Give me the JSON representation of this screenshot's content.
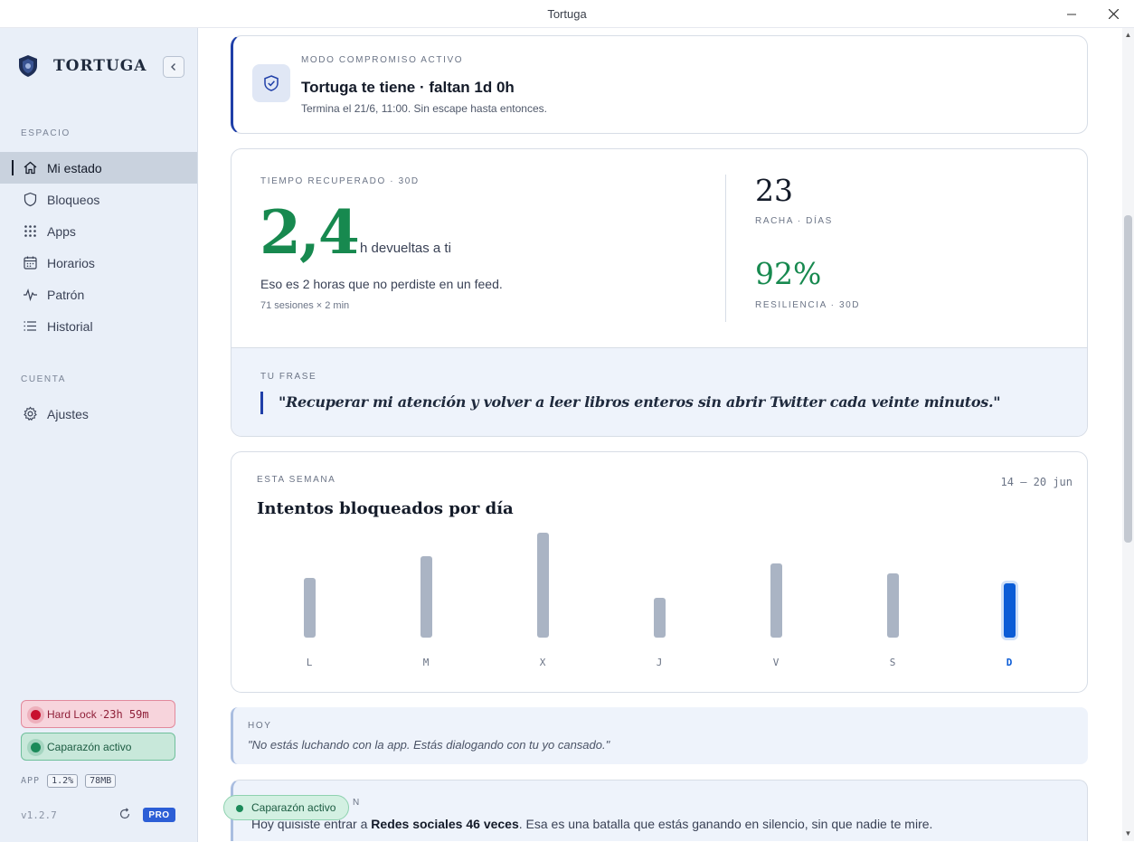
{
  "window": {
    "title": "Tortuga",
    "min_icon": "minimize-icon",
    "close_icon": "close-icon"
  },
  "sidebar": {
    "brand": "TORTUGA",
    "sections": {
      "space": "ESPACIO",
      "account": "CUENTA"
    },
    "items": [
      {
        "label": "Mi estado",
        "icon": "home-icon",
        "active": true
      },
      {
        "label": "Bloqueos",
        "icon": "shield-icon"
      },
      {
        "label": "Apps",
        "icon": "grid-icon"
      },
      {
        "label": "Horarios",
        "icon": "calendar-icon"
      },
      {
        "label": "Patrón",
        "icon": "pulse-icon"
      },
      {
        "label": "Historial",
        "icon": "list-icon"
      }
    ],
    "settings": {
      "label": "Ajustes",
      "icon": "gear-icon"
    },
    "hard_lock": {
      "label": "Hard Lock · ",
      "time": "23h 59m"
    },
    "shell": "Caparazón activo",
    "app": {
      "label": "APP",
      "cpu": "1.2%",
      "mem": "78MB"
    },
    "version": "v1.2.7",
    "pro": "PRO"
  },
  "commit": {
    "eyebrow": "MODO COMPROMISO ACTIVO",
    "title": "Tortuga te tiene · faltan 1d 0h",
    "subtitle": "Termina el 21/6, 11:00. Sin escape hasta entonces."
  },
  "stats": {
    "eyebrow": "TIEMPO RECUPERADO · 30D",
    "hours": "2,4",
    "unit": "h devueltas a ti",
    "desc": "Eso es 2 horas que no perdiste en un feed.",
    "detail": "71 sesiones × 2 min",
    "streak": "23",
    "streak_label": "RACHA · DÍAS",
    "resilience": "92%",
    "resilience_label": "RESILIENCIA · 30D",
    "phrase_label": "TU FRASE",
    "phrase": "\"Recuperar mi atención y volver a leer libros enteros sin abrir Twitter cada veinte minutos.\""
  },
  "week": {
    "eyebrow": "ESTA SEMANA",
    "range": "14 — 20 jun",
    "title": "Intentos bloqueados por día"
  },
  "chart_data": {
    "type": "bar",
    "categories": [
      "L",
      "M",
      "X",
      "J",
      "V",
      "S",
      "D"
    ],
    "values": [
      0.57,
      0.78,
      1.0,
      0.38,
      0.71,
      0.61,
      0.52
    ],
    "highlight": "D",
    "title": "Intentos bloqueados por día",
    "colors": {
      "bar": "#aab4c4",
      "highlight": "#0b5cd6"
    }
  },
  "today": {
    "eyebrow": "HOY",
    "text": "\"No estás luchando con la app. Estás dialogando con tu yo cansado.\""
  },
  "bottom": {
    "eyebrow": "N",
    "text_before": "Hoy quisiste entrar a ",
    "text_bold": "Redes sociales 46 veces",
    "text_after": ". Esa es una batalla que estás ganando en silencio, sin que nadie te mire."
  },
  "toast": {
    "label": "Caparazón activo"
  }
}
